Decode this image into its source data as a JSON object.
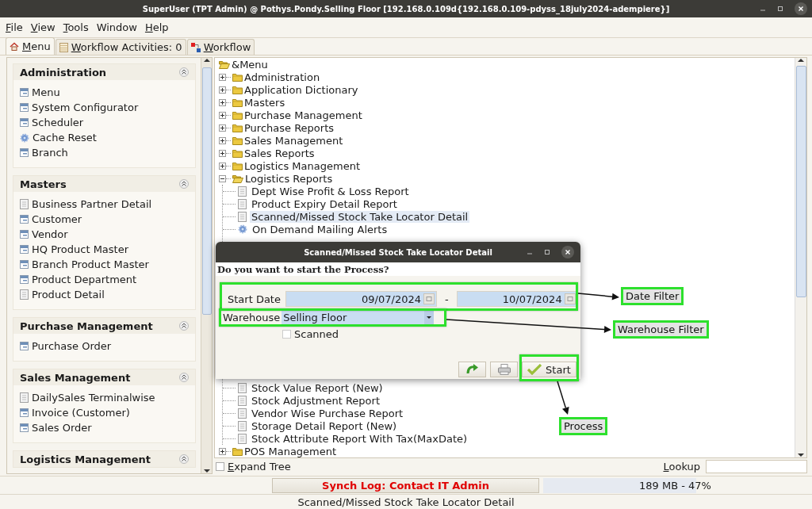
{
  "window": {
    "title": "SuperUser (TPT Admin) @ Pothys.Pondy.Selling Floor [192.168.0.109d{192.168.0.109-pdyss_18july2024-adempiere}]"
  },
  "menu_bar": [
    {
      "label": "File",
      "mnemonic": true
    },
    {
      "label": "View",
      "mnemonic": true
    },
    {
      "label": "Tools",
      "mnemonic": true
    },
    {
      "label": "Window",
      "mnemonic": false
    },
    {
      "label": "Help",
      "mnemonic": true
    }
  ],
  "tabs": [
    {
      "label": "Menu",
      "kind": "home",
      "selected": true
    },
    {
      "label": "Workflow Activities: 0",
      "kind": "activities",
      "selected": false
    },
    {
      "label": "Workflow",
      "kind": "workflow",
      "selected": false
    }
  ],
  "sidebar": {
    "sections": [
      {
        "title": "Administration",
        "expanded": true,
        "items": [
          {
            "label": "Menu",
            "kind": "window"
          },
          {
            "label": "System Configurator",
            "kind": "window"
          },
          {
            "label": "Scheduler",
            "kind": "window"
          },
          {
            "label": "Cache Reset",
            "kind": "process"
          },
          {
            "label": "Branch",
            "kind": "window"
          }
        ]
      },
      {
        "title": "Masters",
        "expanded": true,
        "items": [
          {
            "label": "Business Partner Detail",
            "kind": "report"
          },
          {
            "label": "Customer",
            "kind": "window"
          },
          {
            "label": "Vendor",
            "kind": "window"
          },
          {
            "label": "HQ Product Master",
            "kind": "window"
          },
          {
            "label": "Branch Product Master",
            "kind": "window"
          },
          {
            "label": "Product Department",
            "kind": "window"
          },
          {
            "label": "Product Detail",
            "kind": "report"
          }
        ]
      },
      {
        "title": "Purchase Management",
        "expanded": true,
        "items": [
          {
            "label": "Purchase Order",
            "kind": "window"
          }
        ]
      },
      {
        "title": "Sales Management",
        "expanded": true,
        "items": [
          {
            "label": "DailySales Terminalwise",
            "kind": "report"
          },
          {
            "label": "Invoice (Customer)",
            "kind": "window"
          },
          {
            "label": "Sales Order",
            "kind": "window"
          }
        ]
      },
      {
        "title": "Logistics Management",
        "expanded": true
      }
    ]
  },
  "tree": {
    "root": "&Menu",
    "items": [
      {
        "label": "Administration",
        "expanded": false
      },
      {
        "label": "Application Dictionary",
        "expanded": false
      },
      {
        "label": "Masters",
        "expanded": false
      },
      {
        "label": "Purchase Management",
        "expanded": false
      },
      {
        "label": "Purchase Reports",
        "expanded": false
      },
      {
        "label": "Sales Management",
        "expanded": false
      },
      {
        "label": "Sales Reports",
        "expanded": false
      },
      {
        "label": "Logistics Management",
        "expanded": false
      },
      {
        "label": "Logistics Reports",
        "expanded": true,
        "children": [
          {
            "label": "Dept Wise Profit & Loss Report",
            "kind": "report",
            "selected": false
          },
          {
            "label": "Product Expiry Detail Report",
            "kind": "report",
            "selected": false
          },
          {
            "label": "Scanned/Missed Stock Take Locator Detail",
            "kind": "report",
            "selected": true
          },
          {
            "label": "On Demand Mailing Alerts",
            "kind": "process",
            "selected": false
          },
          {
            "label": "Stock Value Report (New)",
            "kind": "report",
            "selected": false,
            "after_gap": true
          },
          {
            "label": "Stock Adjustment Report",
            "kind": "report",
            "selected": false
          },
          {
            "label": "Vendor Wise Purchase Report",
            "kind": "report",
            "selected": false
          },
          {
            "label": "Storage Detail Report (New)",
            "kind": "report",
            "selected": false
          },
          {
            "label": "Stock Attribute Report With Tax(MaxDate)",
            "kind": "report",
            "selected": false
          }
        ]
      },
      {
        "label": "POS Management",
        "expanded": false
      }
    ]
  },
  "expand_tree": {
    "label": "Expand Tree",
    "checked": false
  },
  "lookup": {
    "label": "Lookup"
  },
  "status_bar": {
    "sync_button": "Synch Log: Contact IT Admin",
    "memory": {
      "reading": "189 MB - 47%",
      "level": 0.58
    },
    "message": "Scanned/Missed Stock Take Locator Detail"
  },
  "dialog": {
    "title": "Scanned/Missed Stock Take Locator Detail",
    "question": "Do you want to start the Process?",
    "start_date": {
      "label": "Start Date",
      "from": "09/07/2024",
      "separator": "-",
      "to": "10/07/2024"
    },
    "warehouse": {
      "label": "Warehouse",
      "value": "Selling Floor"
    },
    "scanned": {
      "label": "Scanned",
      "checked": false
    },
    "buttons": [
      {
        "kind": "redo"
      },
      {
        "kind": "print"
      },
      {
        "kind": "start",
        "label": "Start"
      }
    ]
  },
  "annotations": [
    {
      "label": "Date Filter",
      "kind": "dates"
    },
    {
      "label": "Warehouse Filter",
      "kind": "warehouse"
    },
    {
      "label": "Process",
      "kind": "start"
    }
  ]
}
